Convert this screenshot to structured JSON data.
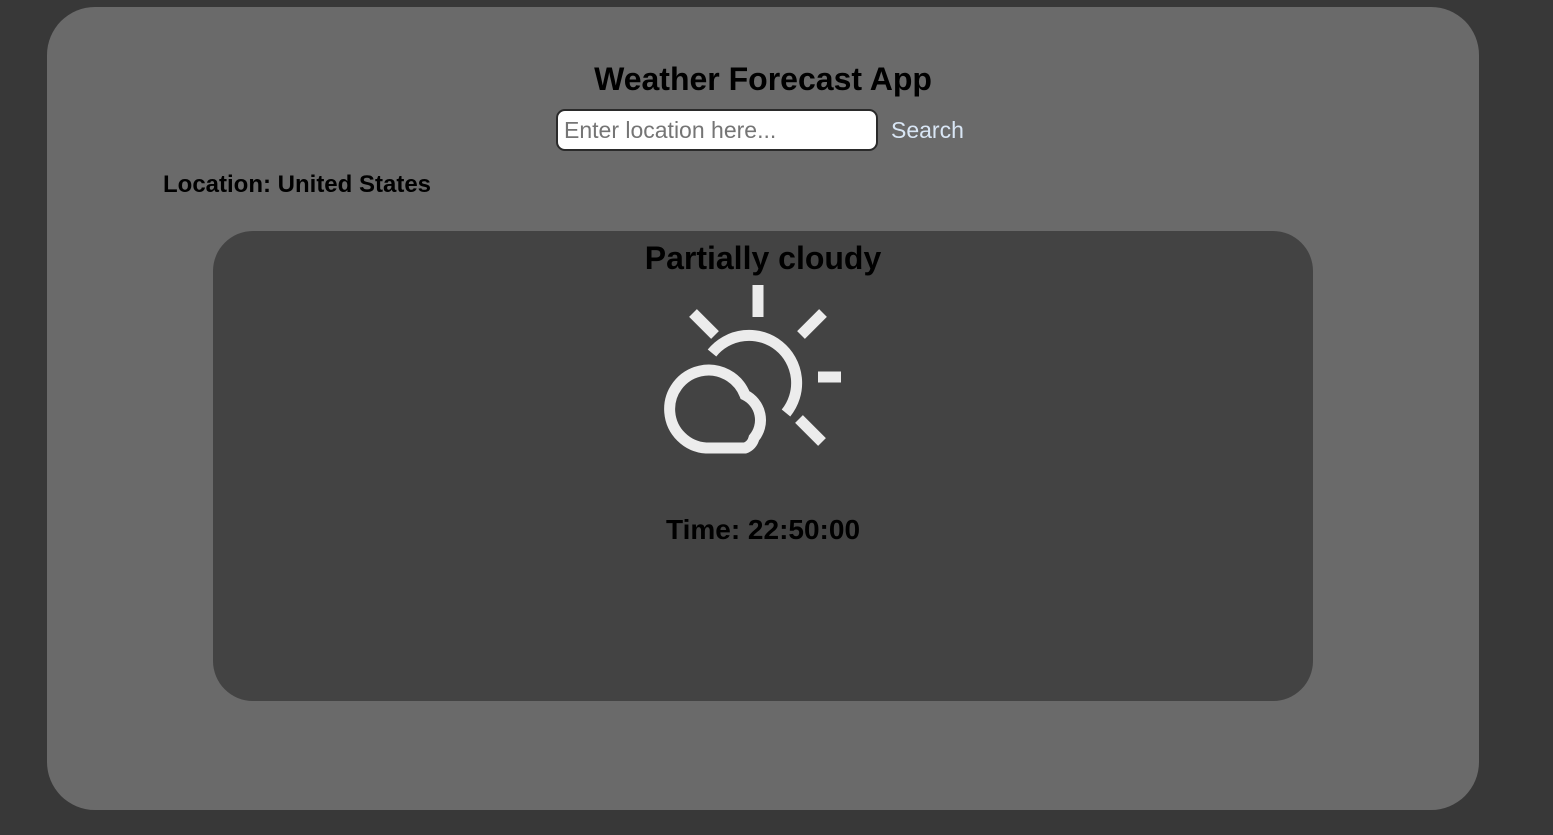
{
  "app": {
    "title": "Weather Forecast App"
  },
  "search": {
    "placeholder": "Enter location here...",
    "value": "",
    "button_label": "Search"
  },
  "location": {
    "text": "Location: United States"
  },
  "weather": {
    "condition": "Partially cloudy",
    "icon": "partly-cloudy-icon",
    "time_text": "Time: 22:50:00"
  },
  "colors": {
    "page_background": "#383838",
    "panel_background": "#6a6a6a",
    "card_background": "#434343",
    "icon_stroke": "#ececec",
    "search_button_text": "#d9e6f5"
  }
}
